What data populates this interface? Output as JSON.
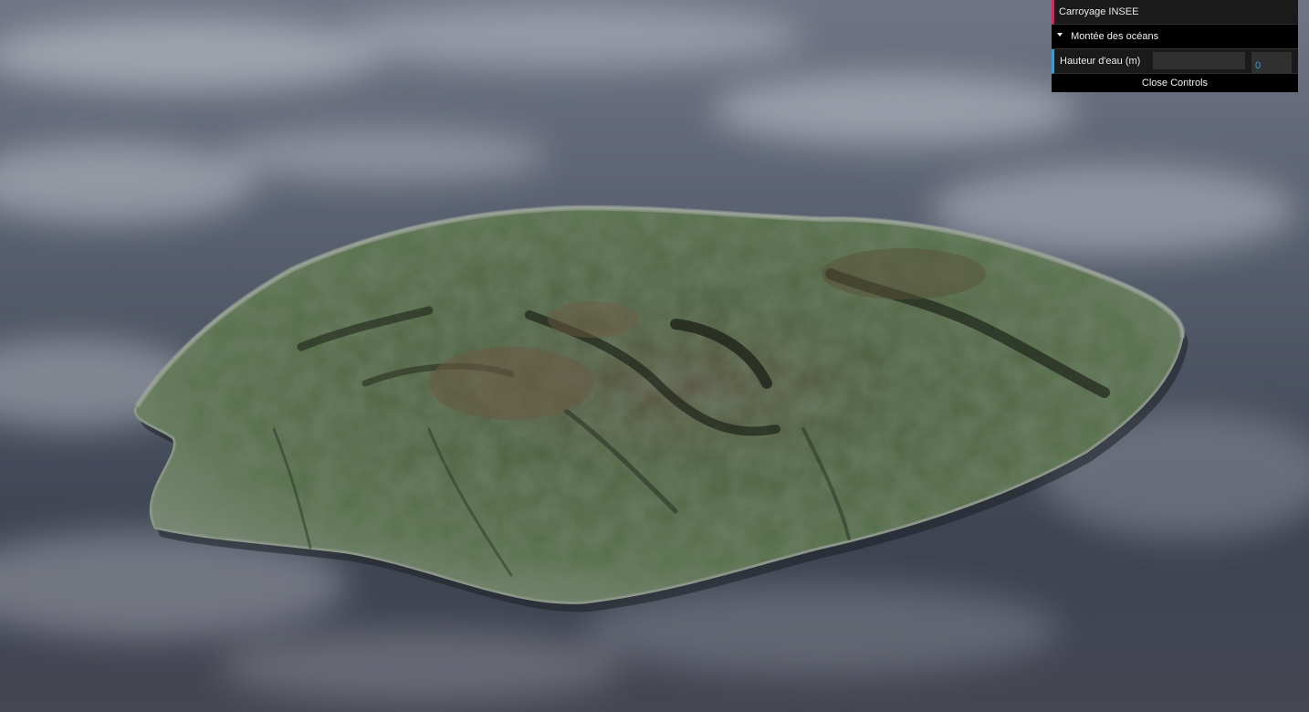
{
  "gui": {
    "folders": [
      {
        "label": "Carroyage INSEE",
        "open": false
      },
      {
        "label": "Montée des océans",
        "open": true,
        "controllers": [
          {
            "label": "Hauteur d'eau (m)",
            "value": "0",
            "fill_fraction": 0
          }
        ]
      }
    ],
    "close_label": "Close Controls"
  },
  "scene": {
    "subject": "3d-terrain-island",
    "ocean_color": "#4a5060",
    "terrain_color": "#4c6440",
    "accent_colors": {
      "folder_link": "#e61d5f",
      "number_controller": "#2fa1d6"
    }
  }
}
